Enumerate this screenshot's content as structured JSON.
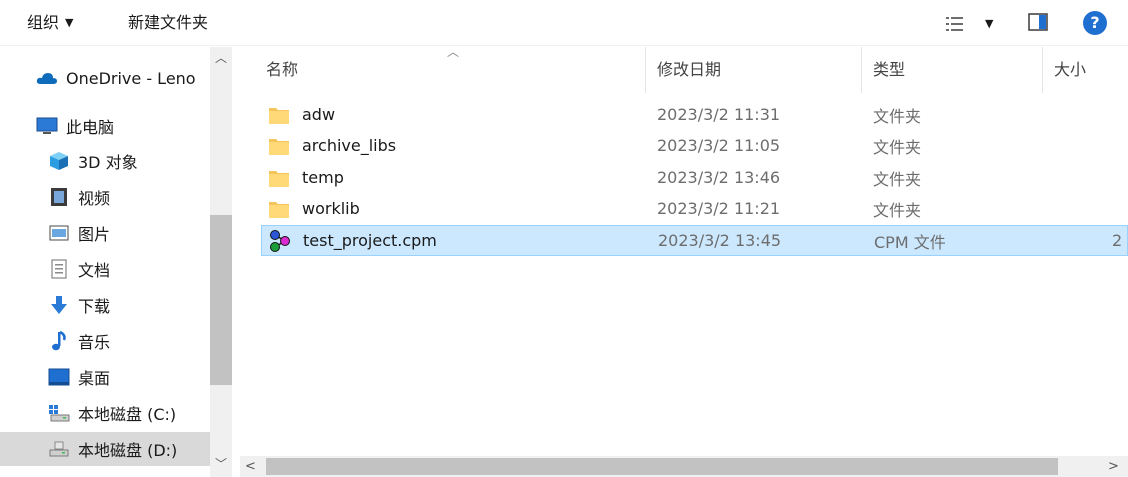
{
  "toolbar": {
    "organize_label": "组织",
    "new_folder_label": "新建文件夹"
  },
  "nav": {
    "items": [
      {
        "label": "OneDrive - Leno",
        "icon": "cloud-icon"
      },
      {
        "label": "此电脑",
        "icon": "computer-icon"
      },
      {
        "label": "3D 对象",
        "icon": "cube-3d-icon"
      },
      {
        "label": "视频",
        "icon": "video-icon"
      },
      {
        "label": "图片",
        "icon": "picture-icon"
      },
      {
        "label": "文档",
        "icon": "document-icon"
      },
      {
        "label": "下载",
        "icon": "download-arrow-icon"
      },
      {
        "label": "音乐",
        "icon": "music-note-icon"
      },
      {
        "label": "桌面",
        "icon": "desktop-icon"
      },
      {
        "label": "本地磁盘 (C:)",
        "icon": "drive-c-icon"
      },
      {
        "label": "本地磁盘 (D:)",
        "icon": "drive-icon"
      }
    ],
    "selected": "本地磁盘 (D:)"
  },
  "list": {
    "columns": {
      "name": "名称",
      "date": "修改日期",
      "type": "类型",
      "size": "大小"
    },
    "rows": [
      {
        "name": "adw",
        "date": "2023/3/2 11:31",
        "type": "文件夹",
        "size": "",
        "icon": "folder-icon"
      },
      {
        "name": "archive_libs",
        "date": "2023/3/2 11:05",
        "type": "文件夹",
        "size": "",
        "icon": "folder-icon"
      },
      {
        "name": "temp",
        "date": "2023/3/2 13:46",
        "type": "文件夹",
        "size": "",
        "icon": "folder-icon"
      },
      {
        "name": "worklib",
        "date": "2023/3/2 11:21",
        "type": "文件夹",
        "size": "",
        "icon": "folder-icon"
      },
      {
        "name": "test_project.cpm",
        "date": "2023/3/2 13:45",
        "type": "CPM 文件",
        "size": "2",
        "icon": "cpm-file-icon"
      }
    ],
    "selected_row": "test_project.cpm"
  },
  "colors": {
    "selection_bg": "#cce8ff",
    "selection_border": "#99d1ff",
    "help_icon": "#1f6fd1",
    "folder": "#f5c45c"
  }
}
